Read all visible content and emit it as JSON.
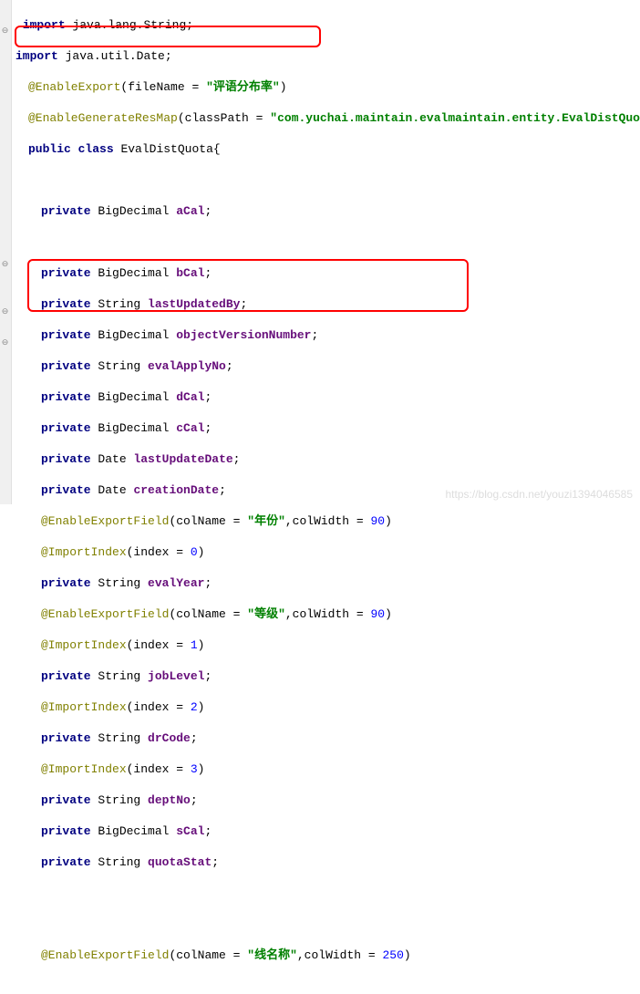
{
  "imports": [
    "import java.lang.String;",
    "import java.util.Date;"
  ],
  "ann_enable_export": {
    "name": "@EnableExport",
    "attr": "fileName",
    "value": "\"评语分布率\""
  },
  "ann_enable_gen": {
    "name": "@EnableGenerateResMap",
    "attr": "classPath",
    "value": "\"com.yuchai.maintain.evalmaintain.entity.EvalDistQuo"
  },
  "class_decl": {
    "kw1": "public",
    "kw2": "class",
    "name": "EvalDistQuota{"
  },
  "fields_top": [
    {
      "mod": "private",
      "type": "BigDecimal",
      "name": "aCal"
    }
  ],
  "fields_block1": [
    {
      "mod": "private",
      "type": "BigDecimal",
      "name": "bCal"
    },
    {
      "mod": "private",
      "type": "String",
      "name": "lastUpdatedBy"
    },
    {
      "mod": "private",
      "type": "BigDecimal",
      "name": "objectVersionNumber"
    },
    {
      "mod": "private",
      "type": "String",
      "name": "evalApplyNo"
    },
    {
      "mod": "private",
      "type": "BigDecimal",
      "name": "dCal"
    },
    {
      "mod": "private",
      "type": "BigDecimal",
      "name": "cCal"
    },
    {
      "mod": "private",
      "type": "Date",
      "name": "lastUpdateDate"
    },
    {
      "mod": "private",
      "type": "Date",
      "name": "creationDate"
    }
  ],
  "exp1": {
    "name": "@EnableExportField",
    "col": "\"年份\"",
    "width": "90"
  },
  "imp1": {
    "name": "@ImportIndex",
    "idx": "0"
  },
  "evalYear": {
    "mod": "private",
    "type": "String",
    "name": "evalYear"
  },
  "exp2": {
    "name": "@EnableExportField",
    "col": "\"等级\"",
    "width": "90"
  },
  "imp2": {
    "name": "@ImportIndex",
    "idx": "1"
  },
  "jobLevel": {
    "mod": "private",
    "type": "String",
    "name": "jobLevel"
  },
  "imp3": {
    "name": "@ImportIndex",
    "idx": "2"
  },
  "drCode": {
    "mod": "private",
    "type": "String",
    "name": "drCode"
  },
  "imp4": {
    "name": "@ImportIndex",
    "idx": "3"
  },
  "deptNo": {
    "mod": "private",
    "type": "String",
    "name": "deptNo"
  },
  "sCal": {
    "mod": "private",
    "type": "BigDecimal",
    "name": "sCal"
  },
  "quotaStat": {
    "mod": "private",
    "type": "String",
    "name": "quotaStat"
  },
  "exp3": {
    "name": "@EnableExportField",
    "col": "\"线名称\"",
    "width": "250"
  },
  "watermark": "https://blog.csdn.net/youzi1394046585"
}
